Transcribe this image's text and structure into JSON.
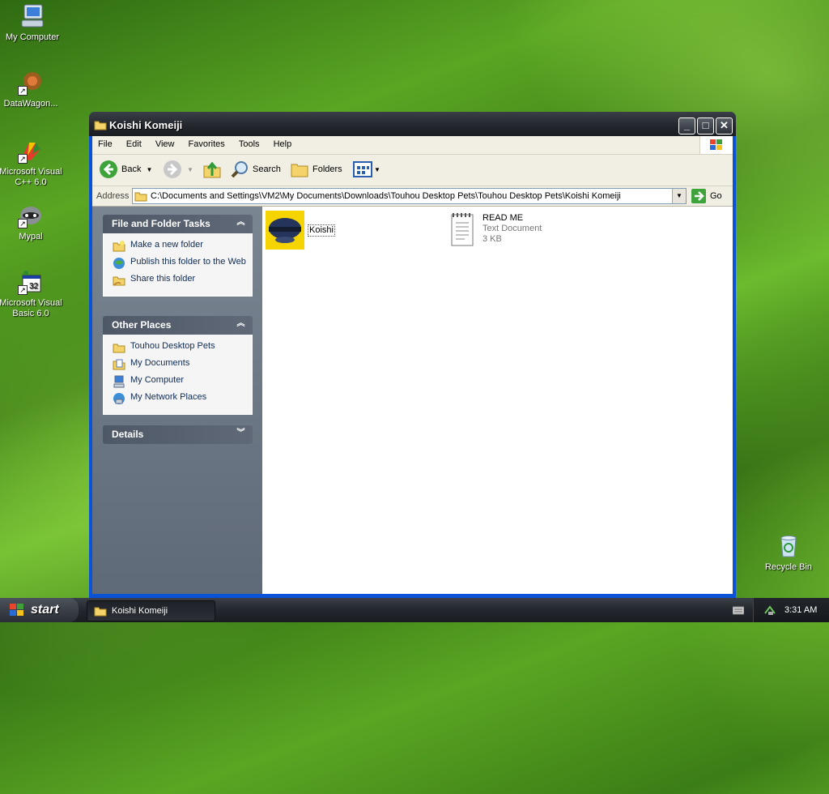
{
  "desktop": {
    "icons": [
      {
        "label": "My Computer"
      },
      {
        "label": "DataWagon..."
      },
      {
        "label": "Microsoft Visual C++ 6.0"
      },
      {
        "label": "Mypal"
      },
      {
        "label": "Microsoft Visual Basic 6.0"
      },
      {
        "label": "Recycle Bin"
      }
    ]
  },
  "window": {
    "title": "Koishi Komeiji",
    "menu": [
      "File",
      "Edit",
      "View",
      "Favorites",
      "Tools",
      "Help"
    ],
    "toolbar": {
      "back": "Back",
      "search": "Search",
      "folders": "Folders"
    },
    "address": {
      "label": "Address",
      "value": "C:\\Documents and Settings\\VM2\\My Documents\\Downloads\\Touhou Desktop Pets\\Touhou Desktop Pets\\Koishi Komeiji",
      "go": "Go"
    },
    "tasks": {
      "title": "File and Folder Tasks",
      "items": [
        "Make a new folder",
        "Publish this folder to the Web",
        "Share this folder"
      ]
    },
    "places": {
      "title": "Other Places",
      "items": [
        "Touhou Desktop Pets",
        "My Documents",
        "My Computer",
        "My Network Places"
      ]
    },
    "details": {
      "title": "Details"
    },
    "files": [
      {
        "name": "Koishi"
      },
      {
        "name": "READ ME",
        "type": "Text Document",
        "size": "3 KB"
      }
    ]
  },
  "taskbar": {
    "start": "start",
    "task": "Koishi Komeiji",
    "clock": "3:31 AM"
  }
}
